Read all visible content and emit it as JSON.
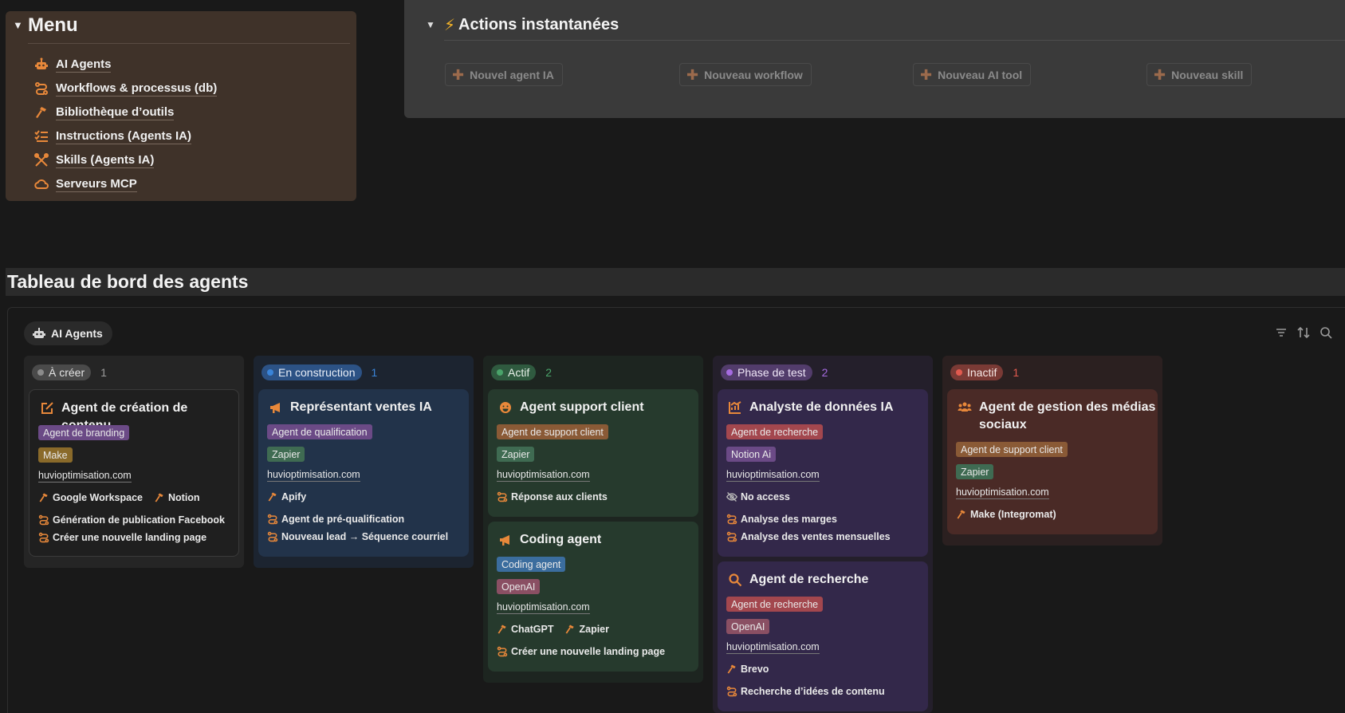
{
  "menu": {
    "title": "Menu",
    "items": [
      {
        "label": "AI Agents",
        "icon": "robot-icon"
      },
      {
        "label": "Workflows & processus (db)",
        "icon": "route-icon"
      },
      {
        "label": "Bibliothèque d’outils",
        "icon": "hammer-icon"
      },
      {
        "label": "Instructions (Agents IA)",
        "icon": "checklist-icon"
      },
      {
        "label": "Skills (Agents IA)",
        "icon": "tools-cross-icon"
      },
      {
        "label": "Serveurs MCP",
        "icon": "cloud-icon"
      }
    ]
  },
  "actions": {
    "title": "Actions instantanées",
    "buttons": [
      "Nouvel agent IA",
      "Nouveau workflow",
      "Nouveau AI tool",
      "Nouveau skill"
    ]
  },
  "dashboard": {
    "title": "Tableau de bord des agents",
    "view_tab": "AI Agents"
  },
  "colors": {
    "accent_orange": "#e8883a",
    "status_gray": "#8c8c8c",
    "status_blue": "#3a84d8",
    "status_green": "#4aa36a",
    "status_purple": "#a56be0",
    "status_red": "#e25a4f"
  },
  "columns": [
    {
      "status": "À créer",
      "count": "1",
      "cards": [
        {
          "title": "Agent de création de contenu",
          "role": "Agent de branding",
          "tool": "Make",
          "url": "huvioptimisation.com",
          "tools_used": [
            "Google Workspace",
            "Notion"
          ],
          "workflows": [
            "Génération de publication Facebook",
            "Créer une nouvelle landing page"
          ]
        }
      ]
    },
    {
      "status": "En construction",
      "count": "1",
      "cards": [
        {
          "title": "Représentant ventes IA",
          "role": "Agent de qualification",
          "tool": "Zapier",
          "url": "huvioptimisation.com",
          "tools_used": [
            "Apify"
          ],
          "workflows": [
            "Agent de pré-qualification",
            "Nouveau lead → Séquence courriel"
          ]
        }
      ]
    },
    {
      "status": "Actif",
      "count": "2",
      "cards": [
        {
          "title": "Agent support client",
          "role": "Agent de support client",
          "tool": "Zapier",
          "url": "huvioptimisation.com",
          "tools_used": [],
          "workflows": [
            "Réponse aux clients"
          ]
        },
        {
          "title": "Coding agent",
          "role": "Coding agent",
          "tool": "OpenAI",
          "url": "huvioptimisation.com",
          "tools_used": [
            "ChatGPT",
            "Zapier"
          ],
          "workflows": [
            "Créer une nouvelle landing page"
          ]
        }
      ]
    },
    {
      "status": "Phase de test",
      "count": "2",
      "cards": [
        {
          "title": "Analyste de données IA",
          "role": "Agent de recherche",
          "tool": "Notion Ai",
          "url": "huvioptimisation.com",
          "access": "No access",
          "workflows": [
            "Analyse des marges",
            "Analyse des ventes mensuelles"
          ]
        },
        {
          "title": "Agent de recherche",
          "role": "Agent de recherche",
          "tool": "OpenAI",
          "url": "huvioptimisation.com",
          "tools_used": [
            "Brevo"
          ],
          "workflows": [
            "Recherche d’idées de contenu"
          ]
        }
      ]
    },
    {
      "status": "Inactif",
      "count": "1",
      "cards": [
        {
          "title_line1": "Agent de gestion des médias",
          "title_line2": "sociaux",
          "role": "Agent de support client",
          "tool": "Zapier",
          "url": "huvioptimisation.com",
          "tools_used": [
            "Make (Integromat)"
          ]
        }
      ]
    }
  ]
}
